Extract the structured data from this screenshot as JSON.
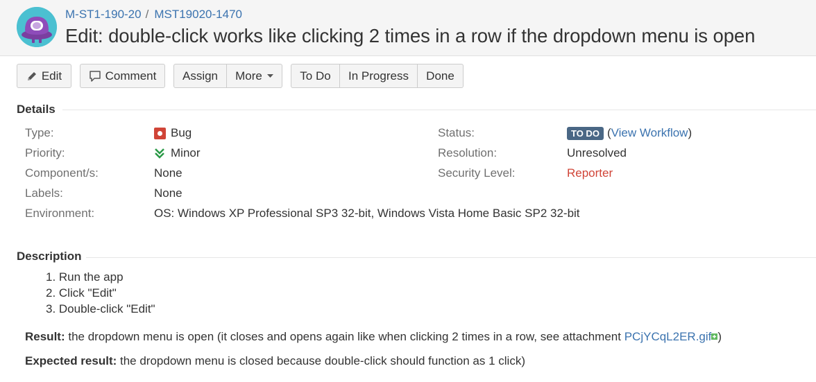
{
  "breadcrumb": {
    "project": "M-ST1-190-20",
    "separator": "/",
    "issue_key": "MST19020-1470"
  },
  "issue": {
    "title": "Edit: double-click works like clicking 2 times in a row if the dropdown menu is open"
  },
  "toolbar": {
    "edit": "Edit",
    "comment": "Comment",
    "assign": "Assign",
    "more": "More",
    "todo": "To Do",
    "in_progress": "In Progress",
    "done": "Done"
  },
  "details": {
    "title": "Details",
    "type_label": "Type:",
    "type_value": "Bug",
    "priority_label": "Priority:",
    "priority_value": "Minor",
    "component_label": "Component/s:",
    "component_value": "None",
    "labels_label": "Labels:",
    "labels_value": "None",
    "environment_label": "Environment:",
    "environment_value": "OS: Windows XP Professional SP3 32-bit, Windows Vista Home Basic SP2 32-bit",
    "status_label": "Status:",
    "status_value": "TO DO",
    "view_workflow": "View Workflow",
    "resolution_label": "Resolution:",
    "resolution_value": "Unresolved",
    "security_label": "Security Level:",
    "security_value": "Reporter"
  },
  "description": {
    "title": "Description",
    "steps": [
      "1. Run the app",
      "2. Click \"Edit\"",
      "3. Double-click \"Edit\""
    ],
    "result_label": "Result:",
    "result_text": "the dropdown menu is open (it closes and opens again like when clicking 2 times in a row, see attachment",
    "attachment": "PCjYCqL2ER.gif",
    "result_close": ")",
    "expected_label": "Expected result:",
    "expected_text": "the dropdown menu is closed because double-click should function as 1 click)"
  },
  "colors": {
    "link": "#3b73af",
    "status_lozenge": "#4a6785",
    "bug": "#d04437",
    "minor": "#2b9a47",
    "reporter": "#d04437"
  },
  "icons": [
    "avatar",
    "pencil-icon",
    "comment-icon",
    "dropdown-caret-icon",
    "bug-icon",
    "priority-minor-icon",
    "attachment-icon"
  ]
}
